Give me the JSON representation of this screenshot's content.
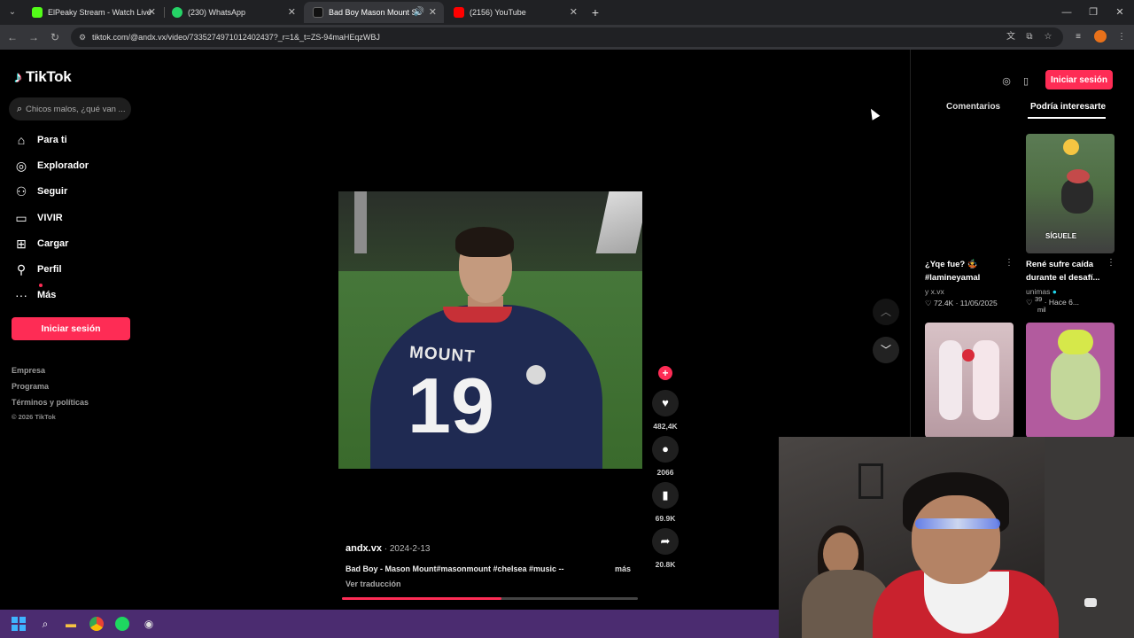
{
  "browser": {
    "tabs": [
      {
        "title": "ElPeaky Stream - Watch Live on",
        "favicon_color": "#53fc18",
        "active": false
      },
      {
        "title": "(230) WhatsApp",
        "favicon_color": "#25d366",
        "active": false
      },
      {
        "title": "Bad Boy Mason Mount Son",
        "favicon_color": "#111111",
        "active": true,
        "audio": true
      },
      {
        "title": "(2156) YouTube",
        "favicon_color": "#ff0000",
        "active": false
      }
    ],
    "url": "tiktok.com/@andx.vx/video/7335274971012402437?_r=1&_t=ZS-94maHEqzWBJ"
  },
  "tiktok": {
    "logo_text": "TikTok",
    "search_placeholder": "Chicos malos, ¿qué van ...",
    "nav": [
      {
        "label": "Para ti",
        "icon": "home-icon"
      },
      {
        "label": "Explorador",
        "icon": "compass-icon"
      },
      {
        "label": "Seguir",
        "icon": "person-icon"
      },
      {
        "label": "VIVIR",
        "icon": "live-icon"
      },
      {
        "label": "Cargar",
        "icon": "upload-icon"
      },
      {
        "label": "Perfil",
        "icon": "profile-icon"
      },
      {
        "label": "Más",
        "icon": "more-icon"
      }
    ],
    "login_button": "Iniciar sesión",
    "footer": {
      "company": "Empresa",
      "program": "Programa",
      "terms": "Términos y políticas",
      "copyright": "© 2026 TikTok"
    },
    "video": {
      "jersey_name": "MOUNT",
      "jersey_number": "19",
      "author": "andx.vx",
      "date": " · 2024-2-13",
      "caption": "Bad Boy   -   Mason Mount#masonmount #chelsea #music --",
      "more": "más",
      "translate": "Ver traducción",
      "progress_fraction": 0.54
    },
    "actions": {
      "likes": "482,4K",
      "comments": "2066",
      "saves": "69.9K",
      "shares": "20.8K"
    },
    "right": {
      "login_button": "Iniciar sesión",
      "tab_comments": "Comentarios",
      "tab_suggested": "Podría interesarte",
      "cards": [
        {
          "title1": "¿Yqe fue? 🤹",
          "title2": "#lamineyamal",
          "author": "y x.vx",
          "likes": "72.4K",
          "date": "· 11/05/2025"
        },
        {
          "title1": "René sufre caída",
          "title2": "durante el desafí...",
          "author": "unimas",
          "likes": "39",
          "likes_unit": "mil",
          "date": "· Hace 6..."
        },
        {
          "thumb_text": "SÍGUELE"
        }
      ]
    }
  },
  "colors": {
    "brand_pink": "#fe2c55",
    "taskbar": "#4b2c70"
  }
}
